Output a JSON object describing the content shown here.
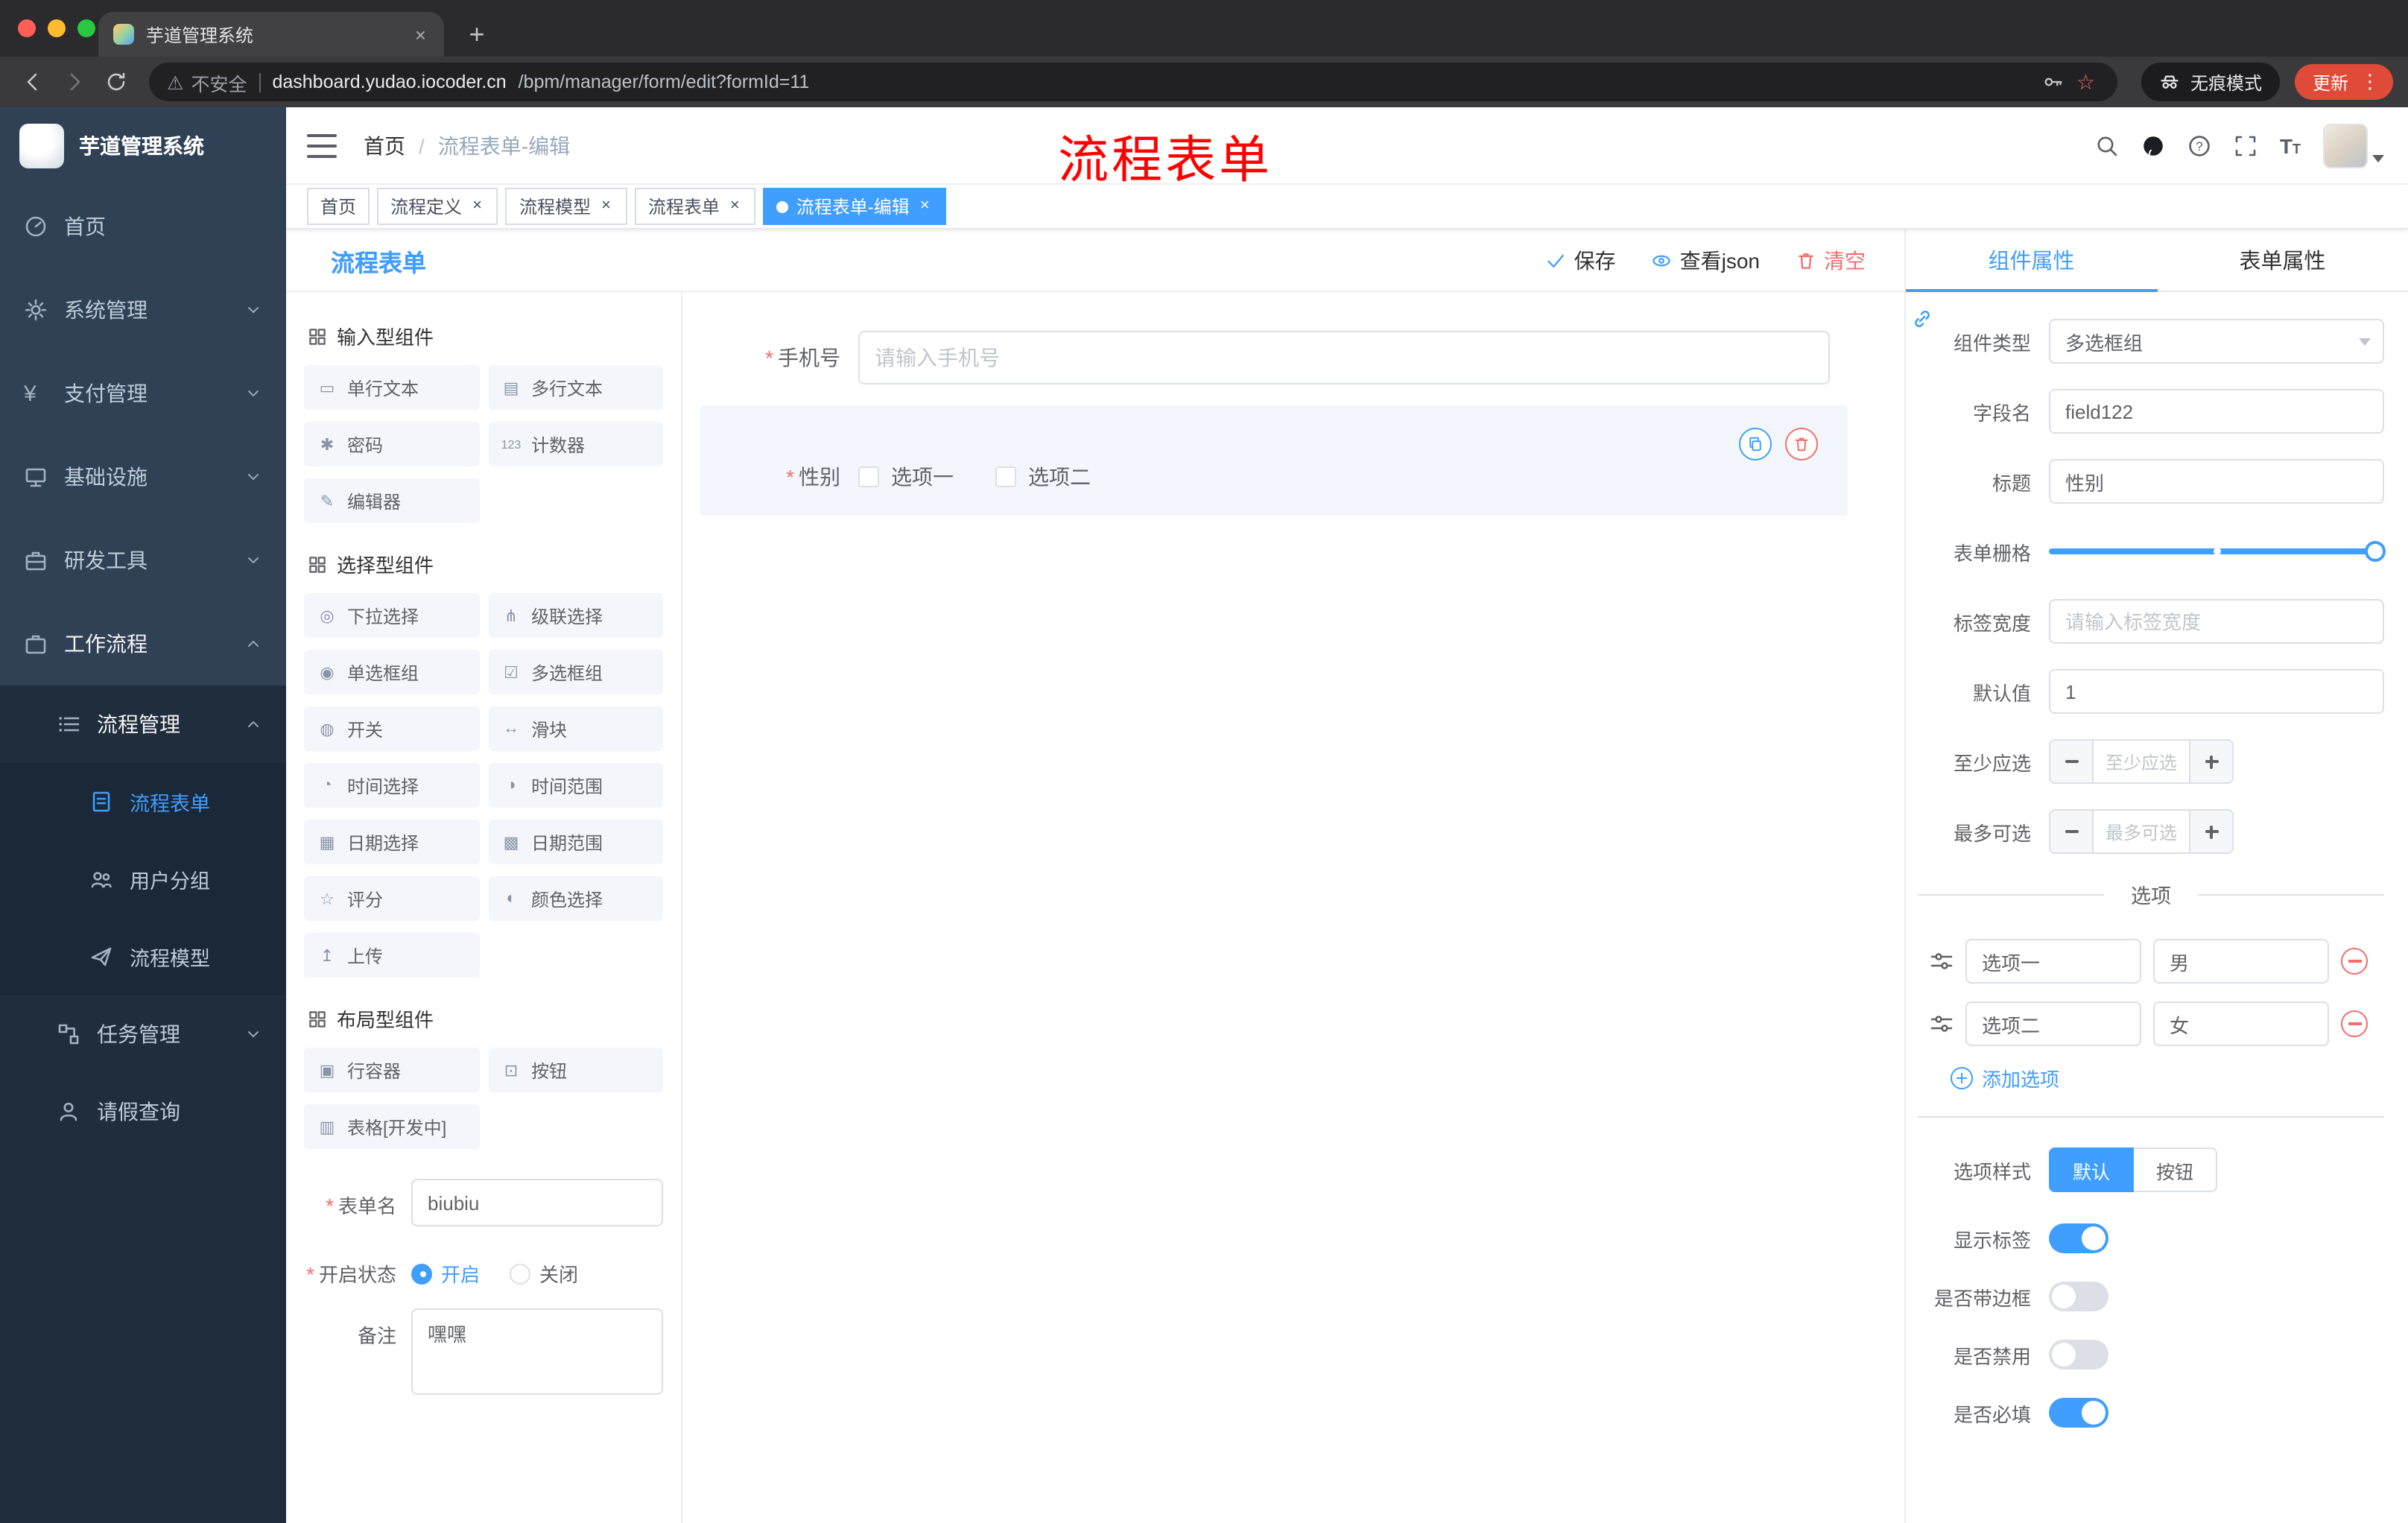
{
  "colors": {
    "accent": "#409eff",
    "danger": "#f56c6c",
    "annotation": "#ff0000",
    "sidebar_bg": "#304156",
    "submenu_bg": "#1f2d3d"
  },
  "ui": {
    "close_glyph": "×",
    "plus_glyph": "+",
    "kebab_glyph": "⋮",
    "star_glyph": "☆",
    "warn_glyph": "⚠",
    "required_glyph": "*"
  },
  "browser": {
    "tab_title": "芋道管理系统",
    "security_label": "不安全",
    "url_host": "dashboard.yudao.iocoder.cn",
    "url_path": "/bpm/manager/form/edit?formId=11",
    "incognito_label": "无痕模式",
    "update_label": "更新"
  },
  "header": {
    "breadcrumb_home": "首页",
    "breadcrumb_sep": "/",
    "breadcrumb_current": "流程表单-编辑",
    "annotation_text": "流程表单"
  },
  "sidebar": {
    "logo_title": "芋道管理系统",
    "items": [
      {
        "label": "首页",
        "icon": "dashboard-icon"
      },
      {
        "label": "系统管理",
        "icon": "gear-icon"
      },
      {
        "label": "支付管理",
        "icon": "yen-icon",
        "glyph": "¥"
      },
      {
        "label": "基础设施",
        "icon": "monitor-icon"
      },
      {
        "label": "研发工具",
        "icon": "toolbox-icon"
      },
      {
        "label": "工作流程",
        "icon": "briefcase-icon"
      },
      {
        "label": "流程管理",
        "icon": "list-icon"
      },
      {
        "label": "流程表单",
        "icon": "document-icon"
      },
      {
        "label": "用户分组",
        "icon": "users-icon"
      },
      {
        "label": "流程模型",
        "icon": "send-icon"
      },
      {
        "label": "任务管理",
        "icon": "flow-icon"
      },
      {
        "label": "请假查询",
        "icon": "person-icon"
      }
    ]
  },
  "tags": [
    {
      "label": "首页"
    },
    {
      "label": "流程定义"
    },
    {
      "label": "流程模型"
    },
    {
      "label": "流程表单"
    },
    {
      "label": "流程表单-编辑"
    }
  ],
  "designer": {
    "title": "流程表单",
    "actions": {
      "save": "保存",
      "view_json": "查看json",
      "clear": "清空"
    },
    "palette": {
      "sections": [
        {
          "title": "输入型组件",
          "items": [
            {
              "label": "单行文本",
              "glyph": "▭",
              "icon": "single-line-input-icon"
            },
            {
              "label": "多行文本",
              "glyph": "▤",
              "icon": "textarea-icon"
            },
            {
              "label": "密码",
              "glyph": "✱",
              "icon": "password-icon"
            },
            {
              "label": "计数器",
              "glyph": "123",
              "icon": "counter-icon"
            },
            {
              "label": "编辑器",
              "glyph": "✎",
              "icon": "editor-icon"
            }
          ]
        },
        {
          "title": "选择型组件",
          "items": [
            {
              "label": "下拉选择",
              "glyph": "◎",
              "icon": "select-icon"
            },
            {
              "label": "级联选择",
              "glyph": "⋔",
              "icon": "cascader-icon"
            },
            {
              "label": "单选框组",
              "glyph": "◉",
              "icon": "radio-group-icon"
            },
            {
              "label": "多选框组",
              "glyph": "☑",
              "icon": "checkbox-group-icon"
            },
            {
              "label": "开关",
              "glyph": "◍",
              "icon": "switch-icon"
            },
            {
              "label": "滑块",
              "glyph": "↔",
              "icon": "slider-icon"
            },
            {
              "label": "时间选择",
              "glyph": "◔",
              "icon": "time-picker-icon"
            },
            {
              "label": "时间范围",
              "glyph": "◑",
              "icon": "time-range-icon"
            },
            {
              "label": "日期选择",
              "glyph": "▦",
              "icon": "date-picker-icon"
            },
            {
              "label": "日期范围",
              "glyph": "▩",
              "icon": "date-range-icon"
            },
            {
              "label": "评分",
              "glyph": "☆",
              "icon": "rate-icon"
            },
            {
              "label": "颜色选择",
              "glyph": "◐",
              "icon": "color-picker-icon"
            },
            {
              "label": "上传",
              "glyph": "↥",
              "icon": "upload-icon"
            }
          ]
        },
        {
          "title": "布局型组件",
          "items": [
            {
              "label": "行容器",
              "glyph": "▣",
              "icon": "row-container-icon"
            },
            {
              "label": "按钮",
              "glyph": "⊡",
              "icon": "button-icon"
            },
            {
              "label": "表格[开发中]",
              "glyph": "▥",
              "icon": "table-icon"
            }
          ]
        }
      ]
    },
    "meta": {
      "name_label": "表单名",
      "name_value": "biubiu",
      "status_label": "开启状态",
      "status_on": "开启",
      "status_off": "关闭",
      "remark_label": "备注",
      "remark_value": "嘿嘿"
    },
    "canvas": {
      "phone": {
        "label": "手机号",
        "placeholder": "请输入手机号"
      },
      "gender": {
        "label": "性别",
        "option1": "选项一",
        "option2": "选项二"
      }
    },
    "props": {
      "tab_component": "组件属性",
      "tab_form": "表单属性",
      "rows": {
        "type_label": "组件类型",
        "type_value": "多选框组",
        "field_label": "字段名",
        "field_value": "field122",
        "title_label": "标题",
        "title_value": "性别",
        "grid_label": "表单栅格",
        "width_label": "标签宽度",
        "width_placeholder": "请输入标签宽度",
        "default_label": "默认值",
        "default_value": "1",
        "min_label": "至少应选",
        "min_placeholder": "至少应选",
        "max_label": "最多可选",
        "max_placeholder": "最多可选"
      },
      "options_title": "选项",
      "options": [
        {
          "name": "选项一",
          "value": "男"
        },
        {
          "name": "选项二",
          "value": "女"
        }
      ],
      "add_option": "添加选项",
      "style_label": "选项样式",
      "style_default": "默认",
      "style_button": "按钮",
      "toggles": [
        {
          "label": "显示标签",
          "on": true
        },
        {
          "label": "是否带边框",
          "on": false
        },
        {
          "label": "是否禁用",
          "on": false
        },
        {
          "label": "是否必填",
          "on": true
        }
      ]
    }
  }
}
